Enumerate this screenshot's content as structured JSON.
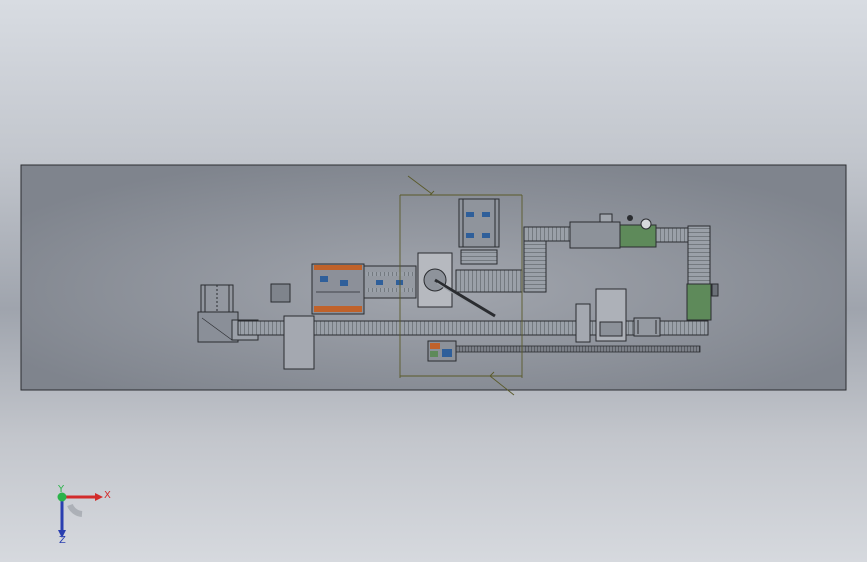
{
  "viewport": {
    "background_top": "#d8dce2",
    "background_mid": "#9fa4ad",
    "background_bottom": "#d6d9de"
  },
  "model": {
    "plane_fill": "#8f949d",
    "plane_border": "#2b2d31",
    "line_color": "#2a2c30",
    "accent_green": "#5e8a5a",
    "accent_orange": "#c0622a",
    "accent_blue": "#2f5f9a",
    "dimension_color": "#5a5a2a"
  },
  "triad": {
    "x_label": "X",
    "y_label": "Y",
    "z_label": "Z",
    "x_color": "#d22b2b",
    "y_color": "#2bb34a",
    "z_color": "#2a3fb0"
  }
}
